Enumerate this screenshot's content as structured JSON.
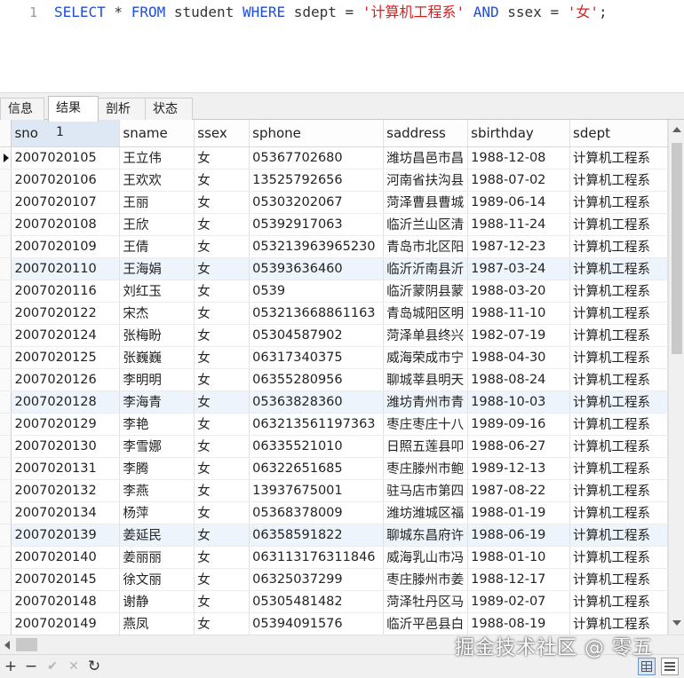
{
  "editor": {
    "line_number": "1",
    "sql": {
      "kw_select": "SELECT",
      "star": " * ",
      "kw_from": "FROM",
      "table": " student ",
      "kw_where": "WHERE",
      "cond1": " sdept = ",
      "str1": "'计算机工程系'",
      "sp1": " ",
      "kw_and": "AND",
      "cond2": " ssex = ",
      "str2": "'女'",
      "semi": ";"
    }
  },
  "tabs": [
    {
      "label": "信息",
      "active": false
    },
    {
      "label": "结果 1",
      "active": true
    },
    {
      "label": "剖析",
      "active": false
    },
    {
      "label": "状态",
      "active": false
    }
  ],
  "grid": {
    "columns": [
      "sno",
      "sname",
      "ssex",
      "sphone",
      "saddress",
      "sbirthday",
      "sdept"
    ],
    "rows": [
      [
        "2007020105",
        "王立伟",
        "女",
        "05367702680",
        "潍坊昌邑市昌",
        "1988-12-08",
        "计算机工程系"
      ],
      [
        "2007020106",
        "王欢欢",
        "女",
        "13525792656",
        "河南省扶沟县",
        "1988-07-02",
        "计算机工程系"
      ],
      [
        "2007020107",
        "王丽",
        "女",
        "05303202067",
        "菏泽曹县曹城",
        "1989-06-14",
        "计算机工程系"
      ],
      [
        "2007020108",
        "王欣",
        "女",
        "05392917063",
        "临沂兰山区清",
        "1988-11-24",
        "计算机工程系"
      ],
      [
        "2007020109",
        "王倩",
        "女",
        "053213963965230",
        "青岛市北区阳",
        "1987-12-23",
        "计算机工程系"
      ],
      [
        "2007020110",
        "王海娟",
        "女",
        "05393636460",
        "临沂沂南县沂",
        "1987-03-24",
        "计算机工程系"
      ],
      [
        "2007020116",
        "刘红玉",
        "女",
        "0539",
        "临沂蒙阴县蒙",
        "1988-03-20",
        "计算机工程系"
      ],
      [
        "2007020122",
        "宋杰",
        "女",
        "053213668861163",
        "青岛城阳区明",
        "1988-11-10",
        "计算机工程系"
      ],
      [
        "2007020124",
        "张梅盼",
        "女",
        "05304587902",
        "菏泽单县终兴",
        "1982-07-19",
        "计算机工程系"
      ],
      [
        "2007020125",
        "张巍巍",
        "女",
        "06317340375",
        "威海荣成市宁",
        "1988-04-30",
        "计算机工程系"
      ],
      [
        "2007020126",
        "李明明",
        "女",
        "06355280956",
        "聊城莘县明天",
        "1988-08-24",
        "计算机工程系"
      ],
      [
        "2007020128",
        "李海青",
        "女",
        "05363828360",
        "潍坊青州市青",
        "1988-10-03",
        "计算机工程系"
      ],
      [
        "2007020129",
        "李艳",
        "女",
        "063213561197363",
        "枣庄枣庄十八",
        "1989-09-16",
        "计算机工程系"
      ],
      [
        "2007020130",
        "李雪娜",
        "女",
        "06335521010",
        "日照五莲县叩",
        "1988-06-27",
        "计算机工程系"
      ],
      [
        "2007020131",
        "李腾",
        "女",
        "06322651685",
        "枣庄滕州市鲍",
        "1989-12-13",
        "计算机工程系"
      ],
      [
        "2007020132",
        "李燕",
        "女",
        "13937675001",
        "驻马店市第四",
        "1987-08-22",
        "计算机工程系"
      ],
      [
        "2007020134",
        "杨萍",
        "女",
        "05368378009",
        "潍坊潍城区福",
        "1988-01-19",
        "计算机工程系"
      ],
      [
        "2007020139",
        "姜延民",
        "女",
        "06358591822",
        "聊城东昌府许",
        "1988-06-19",
        "计算机工程系"
      ],
      [
        "2007020140",
        "姜丽丽",
        "女",
        "063113176311846",
        "威海乳山市冯",
        "1988-01-10",
        "计算机工程系"
      ],
      [
        "2007020145",
        "徐文丽",
        "女",
        "06325037299",
        "枣庄滕州市姜",
        "1988-12-17",
        "计算机工程系"
      ],
      [
        "2007020148",
        "谢静",
        "女",
        "05305481482",
        "菏泽牡丹区马",
        "1989-02-07",
        "计算机工程系"
      ],
      [
        "2007020149",
        "燕凤",
        "女",
        "05394091576",
        "临沂平邑县白",
        "1988-08-19",
        "计算机工程系"
      ]
    ]
  },
  "toolbar": {
    "add": "+",
    "remove": "−",
    "apply": "✔",
    "discard": "✕",
    "refresh": "↻"
  },
  "watermark": "掘金技术社区 @ 零五"
}
